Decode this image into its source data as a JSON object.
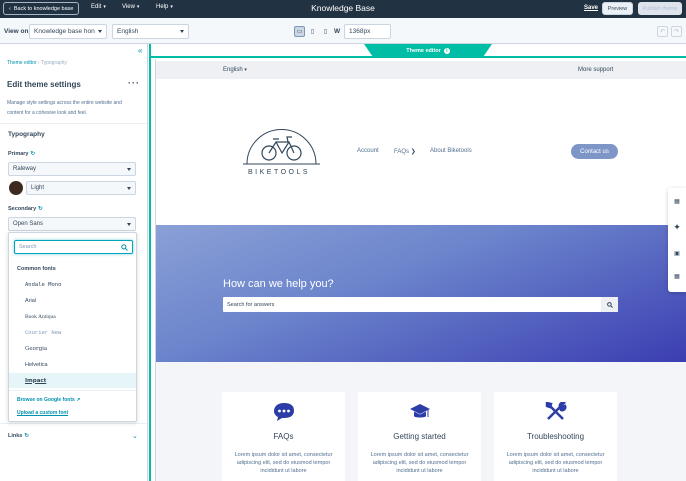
{
  "topbar": {
    "back_label": "Back to knowledge base",
    "menus": [
      "Edit",
      "View",
      "Help"
    ],
    "title": "Knowledge Base",
    "save_label": "Save",
    "preview_label": "Preview",
    "publish_label": "Publish theme"
  },
  "toolbar": {
    "view_on_label": "View on:",
    "view_on_value": "Knowledge base hon",
    "language_value": "English",
    "width_label": "W",
    "width_value": "1368px",
    "undo_label": "↶",
    "redo_label": "↷"
  },
  "panel": {
    "breadcrumb_parent": "Theme editor",
    "breadcrumb_current": "Typography",
    "title": "Edit theme settings",
    "description": "Manage style settings across the entire website and content for a cohesive look and feel.",
    "section_title": "Typography",
    "primary_label": "Primary",
    "primary_font": "Raleway",
    "primary_weight": "Light",
    "primary_color": "#3d2b1f",
    "secondary_label": "Secondary",
    "secondary_font": "Open Sans",
    "links_label": "Links"
  },
  "font_dropdown": {
    "search_placeholder": "Search",
    "group_label": "Common fonts",
    "options": [
      "Andale Mono",
      "Arial",
      "Book Antiqua",
      "Courier New",
      "Georgia",
      "Helvetica",
      "Impact"
    ],
    "highlighted_option": "Impact",
    "browse_link": "Browse on Google fonts",
    "upload_link": "Upload a custom font"
  },
  "preview": {
    "editor_tab_label": "Theme editor",
    "language_label": "English",
    "more_support_label": "More support",
    "brand_name": "BIKETOOLS",
    "nav": [
      "Account",
      "FAQs",
      "About Biketools"
    ],
    "contact_label": "Contact us",
    "hero_title": "How can we help you?",
    "hero_search_placeholder": "Search for answers",
    "cards": [
      {
        "title": "FAQs",
        "icon": "chat-bubble-icon",
        "body": "Lorem ipsum dolor sit amet, consectetur adipiscing elit, sed do eiusmod tempor incididunt ut labore"
      },
      {
        "title": "Getting started",
        "icon": "graduation-cap-icon",
        "body": "Lorem ipsum dolor sit amet, consectetur adipiscing elit, sed do eiusmod tempor incididunt ut labore"
      },
      {
        "title": "Troubleshooting",
        "icon": "tools-icon",
        "body": "Lorem ipsum dolor sit amet, consectetur adipiscing elit, sed do eiusmod tempor incididunt ut labore"
      }
    ]
  },
  "colors": {
    "topbar": "#213343",
    "accent": "#00bda5",
    "link": "#0091ae",
    "hero_start": "#8aa0d6",
    "hero_end": "#3b3eb2",
    "card_icon": "#2d3da8"
  }
}
